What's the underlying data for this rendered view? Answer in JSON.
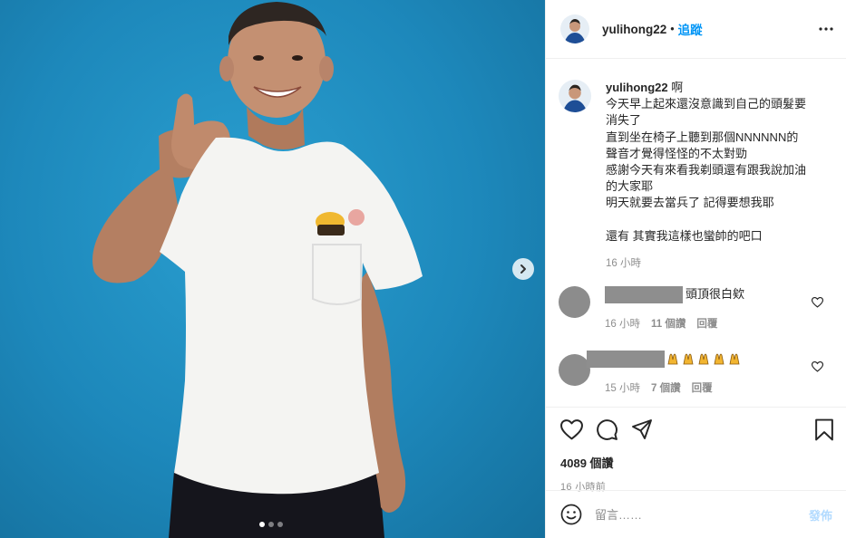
{
  "post": {
    "username": "yulihong22",
    "follow_label": "追蹤",
    "separator": "•"
  },
  "caption": {
    "username": "yulihong22",
    "lines": [
      "啊",
      "今天早上起來還沒意識到自己的頭髮要",
      "消失了",
      "直到坐在椅子上聽到那個NNNNNN的",
      "聲音才覺得怪怪的不太對勁",
      "感謝今天有來看我剃頭還有跟我說加油",
      "的大家耶",
      "明天就要去當兵了 記得要想我耶",
      "",
      "還有 其實我這樣也蠻帥的吧口"
    ],
    "time": "16 小時"
  },
  "comments": [
    {
      "text": "頭頂很白欸",
      "time": "16 小時",
      "likes": "11 個讚",
      "reply": "回覆"
    },
    {
      "text": "",
      "emoji_count": 5,
      "time": "15 小時",
      "likes": "7 個讚",
      "reply": "回覆"
    }
  ],
  "stats": {
    "views": "4089 個讚",
    "posted": "16 小時前"
  },
  "add_comment": {
    "placeholder": "留言……",
    "post_label": "發佈"
  },
  "carousel": {
    "slides": 3,
    "active": 1
  },
  "colors": {
    "accent": "#0095f6",
    "photo_background": "#1d88bb",
    "muted": "#8e8e8e"
  },
  "icons": [
    "more-icon",
    "heart-icon",
    "comment-icon",
    "share-icon",
    "bookmark-icon",
    "emoji-icon",
    "chevron-right-icon"
  ]
}
